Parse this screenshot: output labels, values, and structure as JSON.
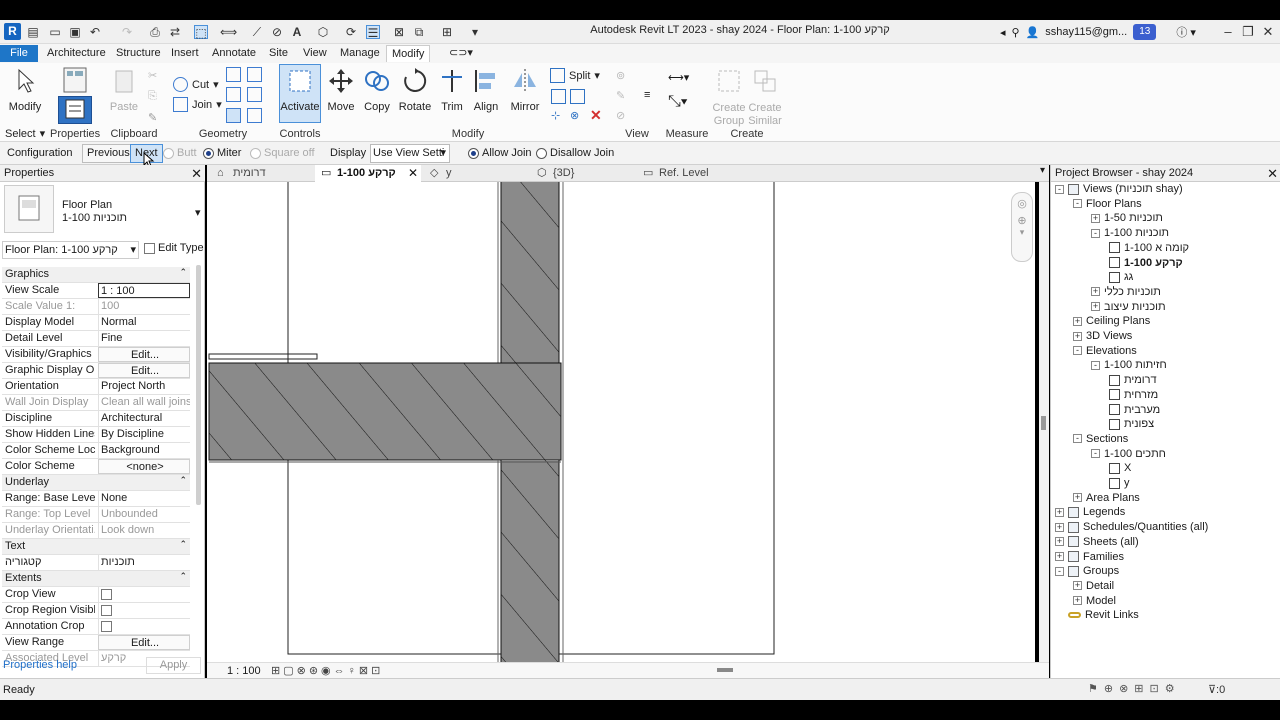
{
  "app": {
    "title": "Autodesk Revit LT 2023 - shay 2024 - Floor Plan: 1-100 קרקע",
    "logo_letter": "R",
    "user": "sshay115@gm...",
    "notifications": "13"
  },
  "ribbon_tabs": [
    "File",
    "Architecture",
    "Structure",
    "Insert",
    "Annotate",
    "Site",
    "View",
    "Manage",
    "Modify"
  ],
  "ribbon": {
    "select": {
      "modify": "Modify",
      "label": "Select"
    },
    "properties": {
      "label": "Properties"
    },
    "clipboard": {
      "paste": "Paste",
      "label": "Clipboard"
    },
    "geometry": {
      "cut": "Cut",
      "join": "Join",
      "label": "Geometry"
    },
    "controls": {
      "activate": "Activate",
      "label": "Controls"
    },
    "modify": {
      "move": "Move",
      "copy": "Copy",
      "rotate": "Rotate",
      "trim": "Trim",
      "align": "Align",
      "mirror": "Mirror",
      "split": "Split",
      "label": "Modify"
    },
    "view": {
      "label": "View"
    },
    "measure": {
      "label": "Measure"
    },
    "create": {
      "group": "Create Group",
      "similar": "Create Similar",
      "label": "Create"
    }
  },
  "options_bar": {
    "configuration": "Configuration",
    "previous": "Previous",
    "next": "Next",
    "butt": "Butt",
    "miter": "Miter",
    "square_off": "Square off",
    "display": "Display",
    "display_value": "Use View Setti",
    "allow_join": "Allow Join",
    "disallow_join": "Disallow Join"
  },
  "properties": {
    "title": "Properties",
    "type_name": "Floor Plan",
    "type_sub": "1-100 תוכניות",
    "selector": "Floor Plan: 1-100 קרקע",
    "edit_type": "Edit Type",
    "help": "Properties help",
    "apply": "Apply",
    "rows": [
      {
        "section": "Graphics"
      },
      {
        "k": "View Scale",
        "v": "1 : 100",
        "box": true
      },
      {
        "k": "Scale Value    1:",
        "v": "100",
        "dis": true
      },
      {
        "k": "Display Model",
        "v": "Normal"
      },
      {
        "k": "Detail Level",
        "v": "Fine"
      },
      {
        "k": "Visibility/Graphics ...",
        "v": "Edit...",
        "btn": true
      },
      {
        "k": "Graphic Display O...",
        "v": "Edit...",
        "btn": true
      },
      {
        "k": "Orientation",
        "v": "Project North"
      },
      {
        "k": "Wall Join Display",
        "v": "Clean all wall joins",
        "dis": true
      },
      {
        "k": "Discipline",
        "v": "Architectural"
      },
      {
        "k": "Show Hidden Lines",
        "v": "By Discipline"
      },
      {
        "k": "Color Scheme Loc...",
        "v": "Background"
      },
      {
        "k": "Color Scheme",
        "v": "<none>",
        "btn": true
      },
      {
        "section": "Underlay"
      },
      {
        "k": "Range: Base Level",
        "v": "None"
      },
      {
        "k": "Range: Top Level",
        "v": "Unbounded",
        "dis": true
      },
      {
        "k": "Underlay Orientati...",
        "v": "Look down",
        "dis": true
      },
      {
        "section": "Text"
      },
      {
        "k": "קטגוריה",
        "v": "תוכניות"
      },
      {
        "section": "Extents"
      },
      {
        "k": "Crop View",
        "chk": true
      },
      {
        "k": "Crop Region Visible",
        "chk": true
      },
      {
        "k": "Annotation Crop",
        "chk": true
      },
      {
        "k": "View Range",
        "v": "Edit...",
        "btn": true
      },
      {
        "k": "Associated Level",
        "v": "קרקע",
        "dis": true
      }
    ]
  },
  "view_tabs": [
    "דרומית",
    "1-100 קרקע",
    "y",
    "{3D}",
    "Ref. Level"
  ],
  "view_control": {
    "scale": "1 : 100"
  },
  "project_browser": {
    "title": "Project Browser - shay 2024",
    "nodes": [
      {
        "t": "Views (תוכניות shay)",
        "lvl": 0,
        "pm": "-",
        "ico": true
      },
      {
        "t": "Floor Plans",
        "lvl": 1,
        "pm": "-"
      },
      {
        "t": "1-50 תוכניות",
        "lvl": 2,
        "pm": "+"
      },
      {
        "t": "1-100 תוכניות",
        "lvl": 2,
        "pm": "-"
      },
      {
        "t": "קומה א 1-100",
        "lvl": 3,
        "view": true
      },
      {
        "t": "1-100 קרקע",
        "lvl": 3,
        "view": true,
        "bold": true
      },
      {
        "t": "גג",
        "lvl": 3,
        "view": true
      },
      {
        "t": "תוכניות כללי",
        "lvl": 2,
        "pm": "+"
      },
      {
        "t": "תוכניות עיצוב",
        "lvl": 2,
        "pm": "+"
      },
      {
        "t": "Ceiling Plans",
        "lvl": 1,
        "pm": "+"
      },
      {
        "t": "3D Views",
        "lvl": 1,
        "pm": "+"
      },
      {
        "t": "Elevations",
        "lvl": 1,
        "pm": "-"
      },
      {
        "t": "1-100 חזיתות",
        "lvl": 2,
        "pm": "-"
      },
      {
        "t": "דרומית",
        "lvl": 3,
        "view": true
      },
      {
        "t": "מזרחית",
        "lvl": 3,
        "view": true
      },
      {
        "t": "מערבית",
        "lvl": 3,
        "view": true
      },
      {
        "t": "צפונית",
        "lvl": 3,
        "view": true
      },
      {
        "t": "Sections",
        "lvl": 1,
        "pm": "-"
      },
      {
        "t": "1-100 חתכים",
        "lvl": 2,
        "pm": "-"
      },
      {
        "t": "X",
        "lvl": 3,
        "view": true
      },
      {
        "t": "y",
        "lvl": 3,
        "view": true
      },
      {
        "t": "Area Plans",
        "lvl": 1,
        "pm": "+"
      },
      {
        "t": "Legends",
        "lvl": 0,
        "pm": "+",
        "ico": true
      },
      {
        "t": "Schedules/Quantities (all)",
        "lvl": 0,
        "pm": "+",
        "ico": true
      },
      {
        "t": "Sheets (all)",
        "lvl": 0,
        "pm": "+",
        "ico": true
      },
      {
        "t": "Families",
        "lvl": 0,
        "pm": "+",
        "ico": true
      },
      {
        "t": "Groups",
        "lvl": 0,
        "pm": "-",
        "ico": true
      },
      {
        "t": "Detail",
        "lvl": 1,
        "pm": "+"
      },
      {
        "t": "Model",
        "lvl": 1,
        "pm": "+"
      },
      {
        "t": "Revit Links",
        "lvl": 0,
        "ico": true,
        "link": true
      }
    ]
  },
  "status": {
    "text": "Ready",
    "filter_count": "0"
  }
}
